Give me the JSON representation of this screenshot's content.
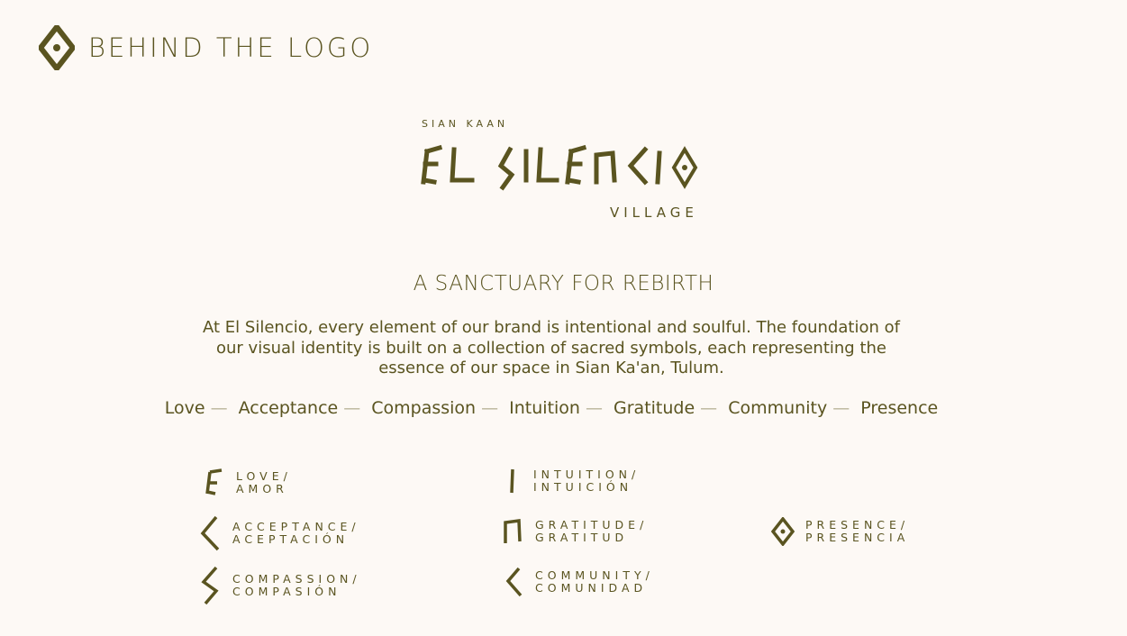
{
  "header": {
    "title": "BEHIND THE LOGO",
    "icon": "diamond-eye-icon"
  },
  "logo": {
    "subtitle": "SIAN KAAN",
    "name_text": "EL SILENCIO",
    "village": "VILLAGE"
  },
  "headline": "A SANCTUARY FOR REBIRTH",
  "intro": "At El Silencio, every element of our brand is intentional and soulful. The foundation of our visual identity is built on a collection of sacred symbols, each representing the essence of our space in Sian Ka'an, Tulum.",
  "values": [
    "Love",
    "Acceptance",
    "Compassion",
    "Intuition",
    "Gratitude",
    "Community",
    "Presence"
  ],
  "values_separator": "—",
  "symbols": [
    {
      "en": "LOVE/",
      "es": "AMOR",
      "icon": "love-symbol-icon"
    },
    {
      "en": "ACCEPTANCE/",
      "es": "ACEPTACIÓN",
      "icon": "acceptance-symbol-icon"
    },
    {
      "en": "COMPASSION/",
      "es": "COMPASIÓN",
      "icon": "compassion-symbol-icon"
    },
    {
      "en": "INTUITION/",
      "es": "INTUICIÓN",
      "icon": "intuition-symbol-icon"
    },
    {
      "en": "GRATITUDE/",
      "es": "GRATITUD",
      "icon": "gratitude-symbol-icon"
    },
    {
      "en": "COMMUNITY/",
      "es": "COMUNIDAD",
      "icon": "community-symbol-icon"
    },
    {
      "en": "PRESENCE/",
      "es": "PRESENCIA",
      "icon": "presence-symbol-icon"
    }
  ],
  "colors": {
    "background": "#fdf9f5",
    "brand_olive": "#5a5420",
    "separator": "#b9b49a"
  }
}
